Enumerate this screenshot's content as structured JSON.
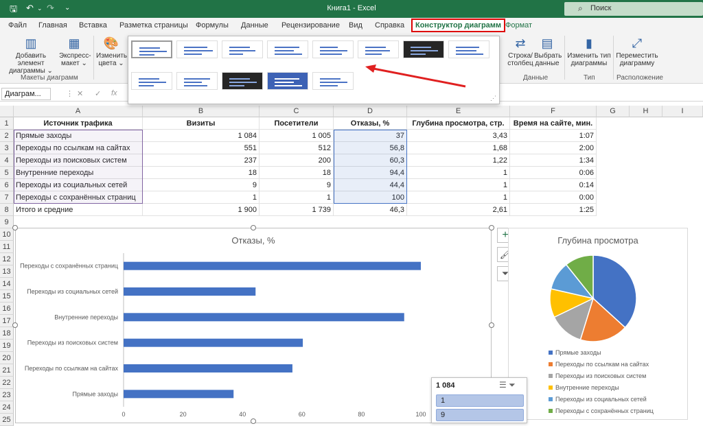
{
  "window": {
    "title": "Книга1  -  Excel",
    "search": "Поиск"
  },
  "tabs": [
    "Файл",
    "Главная",
    "Вставка",
    "Разметка страницы",
    "Формулы",
    "Данные",
    "Рецензирование",
    "Вид",
    "Справка",
    "Конструктор диаграмм",
    "Формат"
  ],
  "ribbon": {
    "add_element": "Добавить элемент диаграммы ⌄",
    "express": "Экспресс-макет ⌄",
    "change_colors": "Изменить цвета ⌄",
    "switch": "Строка/ столбец",
    "select_data": "Выбрать данные",
    "change_type": "Изменить тип диаграммы",
    "move": "Переместить диаграмму",
    "group_layouts": "Макеты диаграмм",
    "group_data": "Данные",
    "group_type": "Тип",
    "group_location": "Расположение"
  },
  "namebox": "Диаграм...",
  "columns": [
    "A",
    "B",
    "C",
    "D",
    "E",
    "F",
    "G",
    "H",
    "I"
  ],
  "rows": [
    "1",
    "2",
    "3",
    "4",
    "5",
    "6",
    "7",
    "8",
    "9",
    "10",
    "11",
    "12",
    "13",
    "14",
    "15",
    "16",
    "17",
    "18",
    "19",
    "20",
    "21",
    "22",
    "23",
    "24",
    "25"
  ],
  "table": {
    "headers": [
      "Источник трафика",
      "Визиты",
      "Посетители",
      "Отказы, %",
      "Глубина просмотра, стр.",
      "Время на сайте, мин."
    ],
    "data": [
      [
        "Прямые заходы",
        "1 084",
        "1 005",
        "37",
        "3,43",
        "1:07"
      ],
      [
        "Переходы по ссылкам на сайтах",
        "551",
        "512",
        "56,8",
        "1,68",
        "2:00"
      ],
      [
        "Переходы из поисковых систем",
        "237",
        "200",
        "60,3",
        "1,22",
        "1:34"
      ],
      [
        "Внутренние переходы",
        "18",
        "18",
        "94,4",
        "1",
        "0:06"
      ],
      [
        "Переходы из социальных сетей",
        "9",
        "9",
        "44,4",
        "1",
        "0:14"
      ],
      [
        "Переходы с сохранённых страниц",
        "1",
        "1",
        "100",
        "1",
        "0:00"
      ],
      [
        "Итого и средние",
        "1 900",
        "1 739",
        "46,3",
        "2,61",
        "1:25"
      ]
    ]
  },
  "chart_data": [
    {
      "type": "bar",
      "title": "Отказы, %",
      "categories": [
        "Прямые заходы",
        "Переходы по ссылкам на сайтах",
        "Переходы из поисковых систем",
        "Внутренние переходы",
        "Переходы из социальных сетей",
        "Переходы с сохранённых страниц"
      ],
      "values": [
        37,
        56.8,
        60.3,
        94.4,
        44.4,
        100
      ],
      "xlim": [
        0,
        100
      ],
      "xticks": [
        "0",
        "20",
        "40",
        "60",
        "80",
        "100"
      ],
      "color": "#4472c4"
    },
    {
      "type": "pie",
      "title": "Глубина просмотра",
      "categories": [
        "Прямые заходы",
        "Переходы по ссылкам на сайтах",
        "Переходы из поисковых систем",
        "Внутренние переходы",
        "Переходы из социальных сетей",
        "Переходы с сохранённых страниц"
      ],
      "values": [
        3.43,
        1.68,
        1.22,
        1,
        1,
        1
      ],
      "colors": [
        "#4472c4",
        "#ed7d31",
        "#a5a5a5",
        "#ffc000",
        "#5b9bd5",
        "#70ad47"
      ],
      "legend": "bottom"
    }
  ],
  "filter": {
    "header": "1 084",
    "items": [
      "1",
      "9"
    ]
  }
}
